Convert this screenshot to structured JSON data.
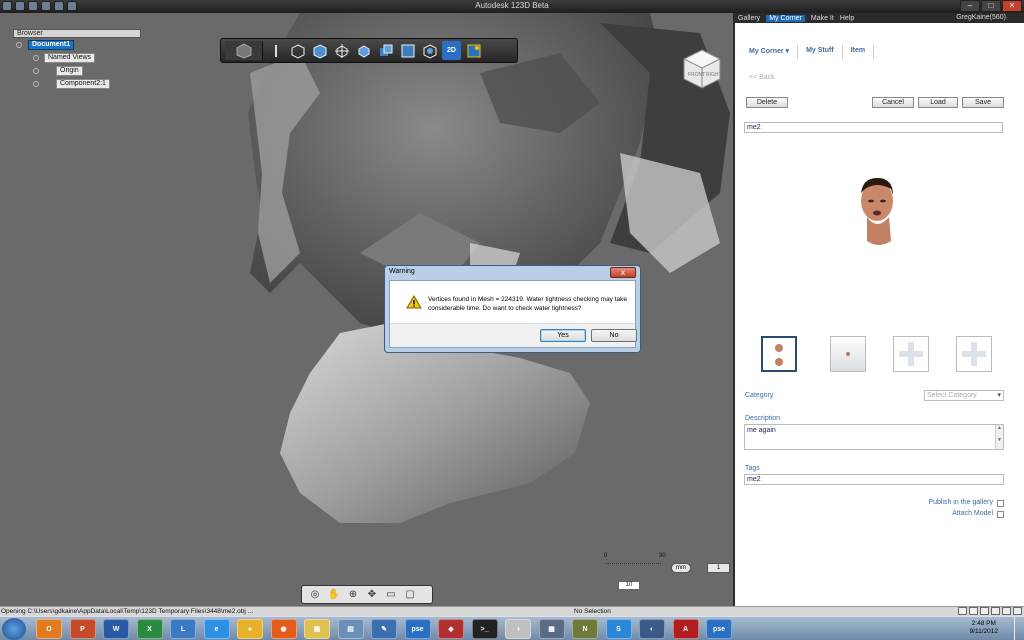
{
  "app": {
    "title": "Autodesk 123D Beta"
  },
  "browser": {
    "title": "Browser",
    "items": [
      {
        "label": "Document1",
        "selected": true
      },
      {
        "label": "Named Views",
        "selected": false
      },
      {
        "label": "Origin",
        "selected": false
      },
      {
        "label": "Component2:1",
        "selected": false
      }
    ]
  },
  "toolbar": {
    "icons": [
      "home-view-icon",
      "sketch-pen-icon",
      "primitive-box-icon",
      "construct-icon",
      "modify-icon",
      "pattern-icon",
      "group-icon",
      "combine-icon",
      "2d-sketch-icon",
      "smart-snap-icon"
    ],
    "icon_2d_label": "2D"
  },
  "viewcube": {
    "front": "FRONT",
    "right": "RIGHT"
  },
  "ruler": {
    "start": "0",
    "end": "30",
    "value": "10",
    "unit": "mm",
    "grid": "1"
  },
  "dialog": {
    "title": "Warning",
    "message": "Vertices found in Mesh = 224319. Water tightness checking may take considerable time. Do want to check water tightness?",
    "yes": "Yes",
    "no": "No",
    "close": "x"
  },
  "panel": {
    "topnav": [
      "Gallery",
      "My Corner",
      "Make It",
      "Help"
    ],
    "active_tab": "My Corner",
    "user": "GregKaine(560)",
    "subnav": [
      "My Corner ▾",
      "My Stuff",
      "Item"
    ],
    "back": "<< Back",
    "buttons": {
      "delete": "Delete",
      "cancel": "Cancel",
      "load": "Load",
      "save": "Save"
    },
    "name": "me2",
    "category_label": "Category",
    "category_placeholder": "Select Category",
    "description_label": "Description",
    "description": "me again",
    "tags_label": "Tags",
    "tags": "me2",
    "publish_label": "Publish in the gallery",
    "attach_label": "Attach Model"
  },
  "status": {
    "left": "Opening C:\\Users\\gdkaine\\AppData\\Local\\Temp\\123D Temporary Files\\3448\\me2.obj ...",
    "middle": "No Selection"
  },
  "taskbar": {
    "apps": [
      "O",
      "P",
      "W",
      "X",
      "L",
      "e",
      "●",
      "◉",
      "▣",
      "▤",
      "✎",
      "pse",
      "◈",
      ">_",
      "◑",
      "▦",
      "N",
      "S",
      "◐",
      "A",
      "pse"
    ],
    "time": "2:48 PM",
    "date": "9/11/2012"
  }
}
